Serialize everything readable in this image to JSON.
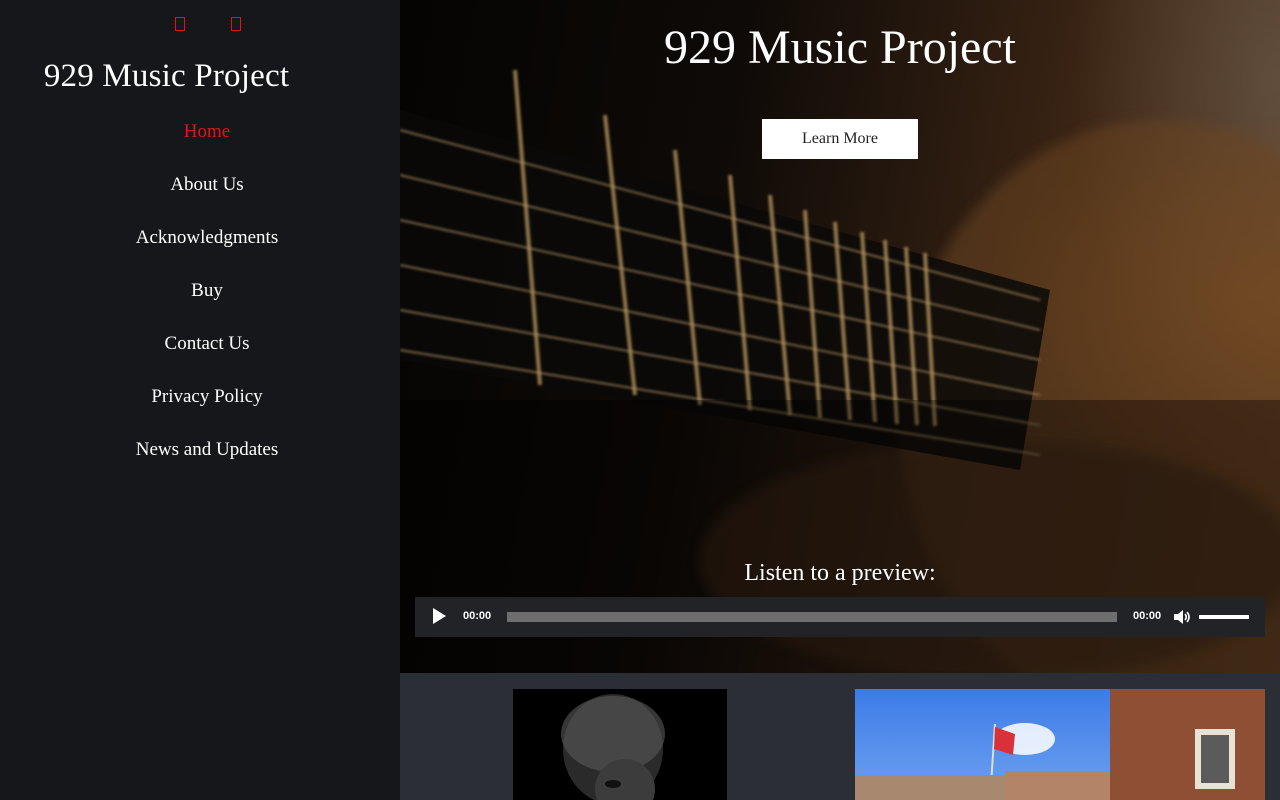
{
  "sidebar": {
    "social_icons": [
      "facebook-icon",
      "instagram-icon"
    ],
    "site_title": "929 Music Project",
    "nav": [
      {
        "label": "Home",
        "active": true
      },
      {
        "label": "About Us"
      },
      {
        "label": "Acknowledgments"
      },
      {
        "label": "Buy"
      },
      {
        "label": "Contact Us"
      },
      {
        "label": "Privacy Policy"
      },
      {
        "label": "News and Updates"
      }
    ]
  },
  "hero": {
    "title": "929 Music Project",
    "button_label": "Learn More",
    "preview_label": "Listen to a preview:",
    "audio": {
      "current_time": "00:00",
      "duration": "00:00",
      "volume": 1.0,
      "progress": 0
    }
  },
  "colors": {
    "accent": "#e1141c",
    "sidebar_bg": "#16171a",
    "lower_bg": "#2c2e36",
    "player_bg": "#222327"
  }
}
